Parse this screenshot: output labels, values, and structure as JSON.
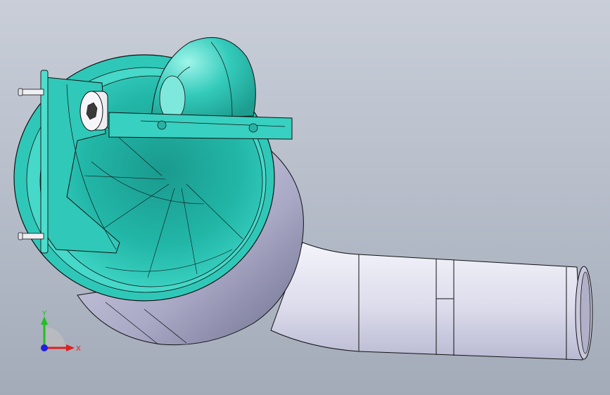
{
  "viewport": {
    "background_top": "#c9ced8",
    "background_bottom": "#a3abb9"
  },
  "model": {
    "housing_color": "#2fc8b8",
    "pipe_color": "#e4e4f2",
    "edge_color": "#111111"
  },
  "triad": {
    "x_label": "X",
    "y_label": "Y",
    "x_color": "#e02020",
    "y_color": "#20c020",
    "z_color": "#2020e0"
  }
}
